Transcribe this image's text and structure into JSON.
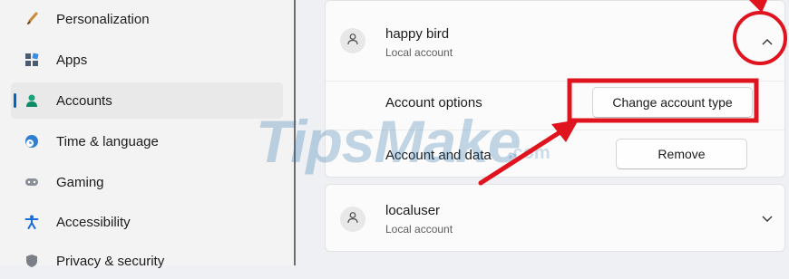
{
  "sidebar": {
    "items": [
      {
        "label": "Personalization",
        "icon": "paintbrush-icon"
      },
      {
        "label": "Apps",
        "icon": "apps-icon"
      },
      {
        "label": "Accounts",
        "icon": "person-icon",
        "active": true
      },
      {
        "label": "Time & language",
        "icon": "globe-clock-icon"
      },
      {
        "label": "Gaming",
        "icon": "gamepad-icon"
      },
      {
        "label": "Accessibility",
        "icon": "accessibility-icon"
      },
      {
        "label": "Privacy & security",
        "icon": "shield-icon"
      }
    ]
  },
  "accounts": [
    {
      "name": "happy bird",
      "type": "Local account",
      "expanded": true,
      "options": {
        "account_options_label": "Account options",
        "change_type_button": "Change account type",
        "account_data_label": "Account and data",
        "remove_button": "Remove"
      }
    },
    {
      "name": "localuser",
      "type": "Local account",
      "expanded": false
    }
  ],
  "watermark": {
    "text": "TipsMake",
    "suffix": ".com"
  },
  "colors": {
    "accent": "#0067c0",
    "annotation": "#e0141e"
  }
}
